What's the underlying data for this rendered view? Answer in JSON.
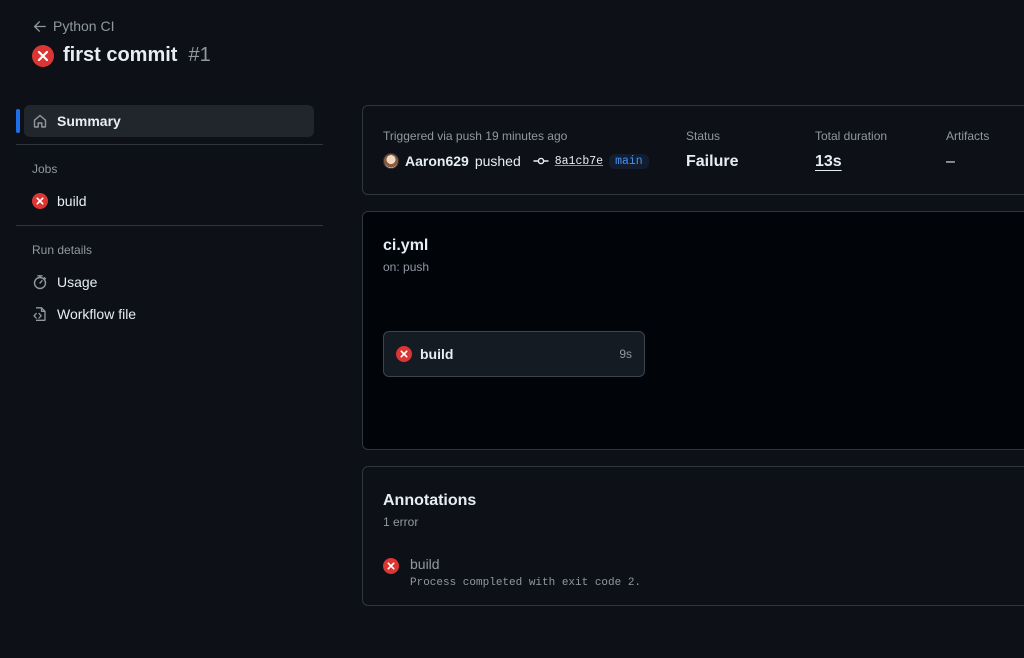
{
  "header": {
    "back_label": "Python CI",
    "run_title": "first commit",
    "run_number": "#1"
  },
  "sidebar": {
    "summary_label": "Summary",
    "jobs_heading": "Jobs",
    "jobs": [
      {
        "label": "build",
        "status": "failure"
      }
    ],
    "run_details_heading": "Run details",
    "details": [
      {
        "label": "Usage",
        "icon": "stopwatch-icon"
      },
      {
        "label": "Workflow file",
        "icon": "file-code-icon"
      }
    ]
  },
  "summary": {
    "trigger_text": "Triggered via push 19 minutes ago",
    "pusher": "Aaron629",
    "pushed_word": "pushed",
    "commit_sha": "8a1cb7e",
    "branch": "main",
    "status_label": "Status",
    "status_value": "Failure",
    "duration_label": "Total duration",
    "duration_value": "13s",
    "artifacts_label": "Artifacts",
    "artifacts_value": "–"
  },
  "workflow": {
    "file_name": "ci.yml",
    "trigger": "on: push",
    "job": {
      "name": "build",
      "duration": "9s"
    }
  },
  "annotations": {
    "title": "Annotations",
    "count": "1 error",
    "items": [
      {
        "job": "build",
        "message": "Process completed with exit code 2."
      }
    ]
  },
  "colors": {
    "background": "#0d1117",
    "failure_red": "#da3633",
    "accent_blue": "#1f6feb",
    "link_blue": "#4493f8"
  }
}
